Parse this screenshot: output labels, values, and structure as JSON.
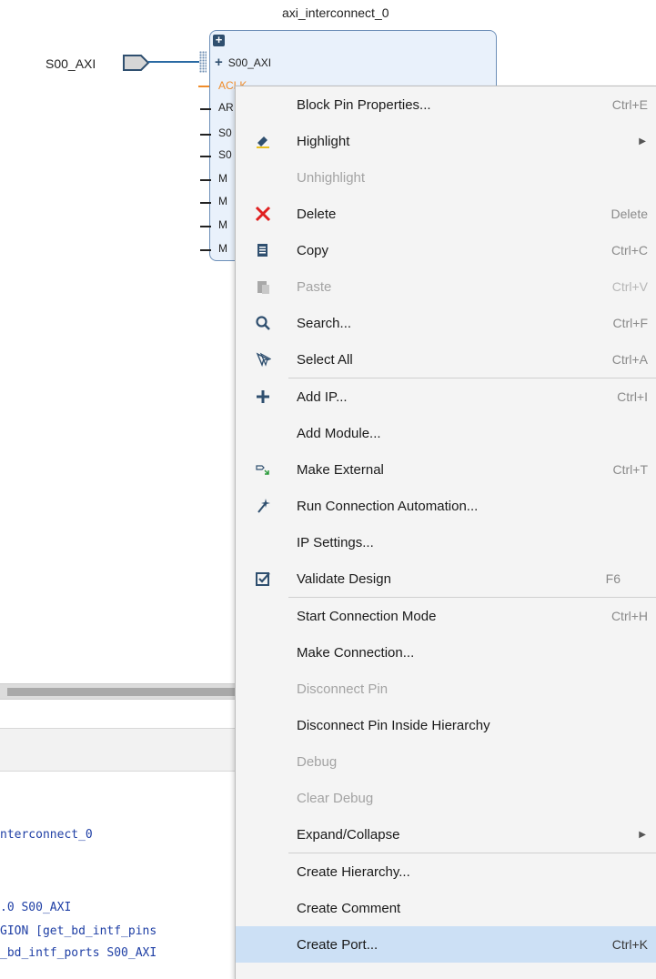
{
  "canvas": {
    "block_title": "axi_interconnect_0",
    "external_port_label": "S00_AXI",
    "block": {
      "expand_symbol": "+",
      "interface_pin": "S00_AXI",
      "pins": [
        "ACLK",
        "AR",
        "S0",
        "S0",
        "M",
        "M",
        "M",
        "M"
      ]
    }
  },
  "tcl_console": {
    "lines": [
      "nterconnect_0",
      ".0 S00_AXI",
      "GION [get_bd_intf_pins",
      "_bd_intf_ports S00_AXI"
    ]
  },
  "context_menu": {
    "items": [
      {
        "label": "Block Pin Properties...",
        "shortcut": "Ctrl+E",
        "icon": ""
      },
      {
        "label": "Highlight",
        "shortcut": "",
        "icon": "highlight-pen-icon",
        "submenu": true
      },
      {
        "label": "Unhighlight",
        "shortcut": "",
        "icon": "",
        "disabled": true
      },
      {
        "label": "Delete",
        "shortcut": "Delete",
        "icon": "delete-x-icon"
      },
      {
        "label": "Copy",
        "shortcut": "Ctrl+C",
        "icon": "copy-icon"
      },
      {
        "label": "Paste",
        "shortcut": "Ctrl+V",
        "icon": "paste-icon",
        "disabled": true
      },
      {
        "label": "Search...",
        "shortcut": "Ctrl+F",
        "icon": "search-icon"
      },
      {
        "label": "Select All",
        "shortcut": "Ctrl+A",
        "icon": "select-all-icon"
      },
      {
        "label": "Add IP...",
        "shortcut": "Ctrl+I",
        "icon": "plus-icon"
      },
      {
        "label": "Add Module...",
        "shortcut": "",
        "icon": ""
      },
      {
        "label": "Make External",
        "shortcut": "Ctrl+T",
        "icon": "make-external-icon"
      },
      {
        "label": "Run Connection Automation...",
        "shortcut": "",
        "icon": "magic-wand-icon"
      },
      {
        "label": "IP Settings...",
        "shortcut": "",
        "icon": ""
      },
      {
        "label": "Validate Design",
        "shortcut": "F6",
        "icon": "validate-check-icon"
      },
      {
        "label": "Start Connection Mode",
        "shortcut": "Ctrl+H",
        "icon": ""
      },
      {
        "label": "Make Connection...",
        "shortcut": "",
        "icon": ""
      },
      {
        "label": "Disconnect Pin",
        "shortcut": "",
        "icon": "",
        "disabled": true
      },
      {
        "label": "Disconnect Pin Inside Hierarchy",
        "shortcut": "",
        "icon": ""
      },
      {
        "label": "Debug",
        "shortcut": "",
        "icon": "",
        "disabled": true
      },
      {
        "label": "Clear Debug",
        "shortcut": "",
        "icon": "",
        "disabled": true
      },
      {
        "label": "Expand/Collapse",
        "shortcut": "",
        "icon": "",
        "submenu": true
      },
      {
        "label": "Create Hierarchy...",
        "shortcut": "",
        "icon": ""
      },
      {
        "label": "Create Comment",
        "shortcut": "",
        "icon": ""
      },
      {
        "label": "Create Port...",
        "shortcut": "Ctrl+K",
        "icon": "",
        "hovered": true
      }
    ]
  },
  "colors": {
    "menu_bg": "#f4f4f4",
    "hover_bg": "#cce0f5",
    "delete_red": "#e02020",
    "icon_blue": "#2f4f6f",
    "wire_blue": "#2a6aa3",
    "tcl_blue": "#1f3fa5"
  }
}
